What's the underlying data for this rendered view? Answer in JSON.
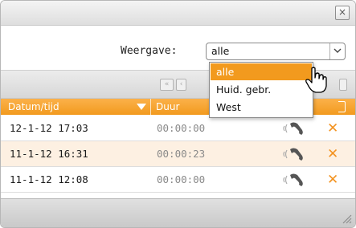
{
  "window": {
    "close_label": "×"
  },
  "filter": {
    "label": "Weergave:",
    "selected": "alle",
    "options": [
      "alle",
      "Huid. gebr.",
      "West"
    ]
  },
  "pager": {
    "first_label": "«",
    "prev_label": "‹"
  },
  "table": {
    "columns": [
      "Datum/tijd",
      "Duur"
    ],
    "rows": [
      {
        "datetime": "12-1-12 17:03",
        "duration": "00:00:00"
      },
      {
        "datetime": "11-1-12 16:31",
        "duration": "00:00:23"
      },
      {
        "datetime": "11-1-12 12:08",
        "duration": "00:00:00"
      }
    ]
  },
  "icons": {
    "close": "close-icon",
    "phone": "phone-call-icon",
    "delete": "delete-x-icon",
    "resize": "resize-grip-icon",
    "cursor": "hand-pointer-icon"
  },
  "colors": {
    "accent": "#f29a1e",
    "alt_row": "#fdf0e2",
    "delete": "#f39321"
  }
}
